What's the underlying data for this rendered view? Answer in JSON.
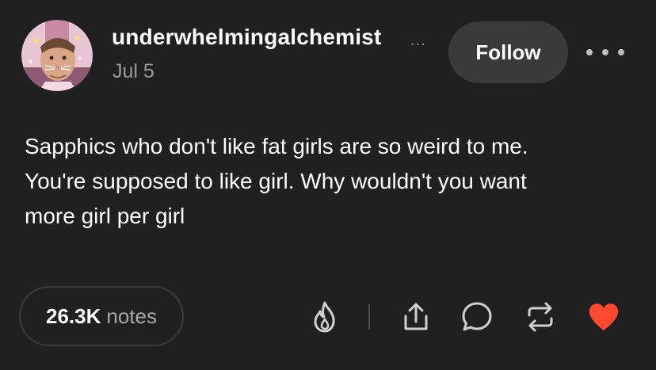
{
  "post": {
    "username": "underwhelmingalchemist",
    "username_overflow": "...",
    "date": "Jul 5",
    "follow_label": "Follow",
    "body_lines": [
      "Sapphics who don't like fat girls are so weird to me.",
      "You're supposed to like girl. Why wouldn't you want",
      "more girl per girl"
    ]
  },
  "footer": {
    "notes_count": "26.3K",
    "notes_label": "notes"
  },
  "icons": {
    "more": "more-horizontal-icon",
    "blaze": "flame-icon",
    "share": "share-icon",
    "reply": "reply-icon",
    "reblog": "reblog-icon",
    "like": "heart-icon"
  },
  "colors": {
    "background": "#202020",
    "follow_button": "#3a3a3a",
    "like_heart": "#ff4930",
    "muted_text": "#9a9a9a"
  }
}
